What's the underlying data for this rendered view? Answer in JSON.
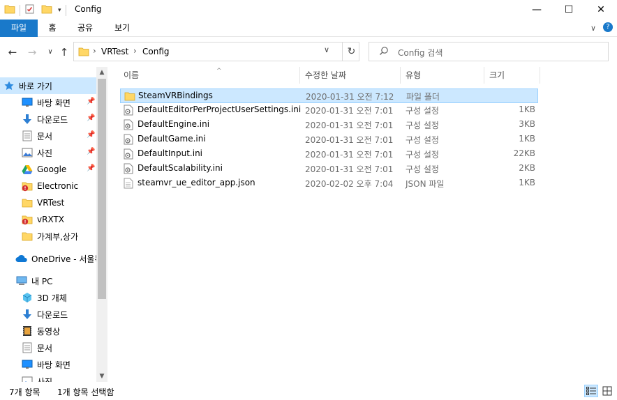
{
  "window": {
    "title": "Config",
    "min_glyph": "—",
    "max_glyph": "☐",
    "close_glyph": "✕"
  },
  "ribbon": {
    "tabs": [
      {
        "label": "파일"
      },
      {
        "label": "홈"
      },
      {
        "label": "공유"
      },
      {
        "label": "보기"
      }
    ],
    "expand_glyph": "∨",
    "help_glyph": "?"
  },
  "nav": {
    "back_glyph": "←",
    "forward_glyph": "→",
    "recent_glyph": "∨",
    "up_glyph": "↑",
    "breadcrumb": [
      {
        "label": "VRTest"
      },
      {
        "label": "Config"
      }
    ],
    "crumb_sep": "›",
    "dropdown_glyph": "∨",
    "refresh_glyph": "↻",
    "search_placeholder": "Config 검색"
  },
  "sidebar": {
    "items": [
      {
        "label": "바로 가기",
        "icon": "star-icon",
        "pinned": false,
        "selected": true
      },
      {
        "label": "바탕 화면",
        "icon": "desktop-icon",
        "pinned": true
      },
      {
        "label": "다운로드",
        "icon": "download-icon",
        "pinned": true
      },
      {
        "label": "문서",
        "icon": "document-icon",
        "pinned": true
      },
      {
        "label": "사진",
        "icon": "picture-icon",
        "pinned": true
      },
      {
        "label": "Google",
        "icon": "google-drive-icon",
        "pinned": true
      },
      {
        "label": "Electronic",
        "icon": "folder-error-icon",
        "pinned": false
      },
      {
        "label": "VRTest",
        "icon": "folder-icon",
        "pinned": false
      },
      {
        "label": "vRXTX",
        "icon": "folder-error-icon",
        "pinned": false
      },
      {
        "label": "가계부,상가",
        "icon": "folder-icon",
        "pinned": false
      },
      {
        "label": "OneDrive - 서울특",
        "icon": "onedrive-icon",
        "pinned": false
      },
      {
        "label": "내 PC",
        "icon": "pc-icon",
        "pinned": false
      },
      {
        "label": "3D 개체",
        "icon": "cube-3d-icon",
        "pinned": false
      },
      {
        "label": "다운로드",
        "icon": "download-icon",
        "pinned": false
      },
      {
        "label": "동영상",
        "icon": "video-icon",
        "pinned": false
      },
      {
        "label": "문서",
        "icon": "document-icon",
        "pinned": false
      },
      {
        "label": "바탕 화면",
        "icon": "desktop-icon",
        "pinned": false
      },
      {
        "label": "사진",
        "icon": "picture-icon",
        "pinned": false
      }
    ],
    "pin_glyph": "📌"
  },
  "files": {
    "columns": [
      {
        "label": "이름"
      },
      {
        "label": "수정한 날짜"
      },
      {
        "label": "유형"
      },
      {
        "label": "크기"
      }
    ],
    "sort_glyph": "^",
    "rows": [
      {
        "name": "SteamVRBindings",
        "date": "2020-01-31 오전 7:12",
        "type": "파일 폴더",
        "size": "",
        "icon": "folder-icon",
        "selected": true
      },
      {
        "name": "DefaultEditorPerProjectUserSettings.ini",
        "date": "2020-01-31 오전 7:01",
        "type": "구성 설정",
        "size": "1KB",
        "icon": "ini-file-icon"
      },
      {
        "name": "DefaultEngine.ini",
        "date": "2020-01-31 오전 7:01",
        "type": "구성 설정",
        "size": "3KB",
        "icon": "ini-file-icon"
      },
      {
        "name": "DefaultGame.ini",
        "date": "2020-01-31 오전 7:01",
        "type": "구성 설정",
        "size": "1KB",
        "icon": "ini-file-icon"
      },
      {
        "name": "DefaultInput.ini",
        "date": "2020-01-31 오전 7:01",
        "type": "구성 설정",
        "size": "22KB",
        "icon": "ini-file-icon"
      },
      {
        "name": "DefaultScalability.ini",
        "date": "2020-01-31 오전 7:01",
        "type": "구성 설정",
        "size": "2KB",
        "icon": "ini-file-icon"
      },
      {
        "name": "steamvr_ue_editor_app.json",
        "date": "2020-02-02 오후 7:04",
        "type": "JSON 파일",
        "size": "1KB",
        "icon": "json-file-icon"
      }
    ]
  },
  "status": {
    "item_count": "7개 항목",
    "selected_count": "1개 항목 선택함"
  },
  "colors": {
    "accent": "#1979ca",
    "selection": "#cce8ff",
    "selection_border": "#99d1ff",
    "folder": "#ffd766"
  }
}
